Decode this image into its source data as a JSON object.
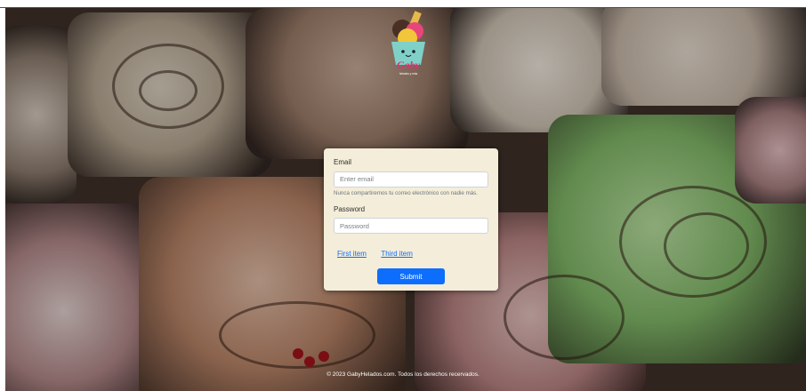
{
  "logo": {
    "name": "Gaby",
    "tagline": "helados y más"
  },
  "form": {
    "email_label": "Email",
    "email_placeholder": "Enter email",
    "email_help": "Nunca compartiremos tu correo electrónico con nadie más.",
    "password_label": "Password",
    "password_placeholder": "Password",
    "links": [
      "First item",
      "Third item"
    ],
    "submit_label": "Submit"
  },
  "footer": {
    "text": "© 2023 GabyHelados.com. Todos los derechos recervados."
  },
  "colors": {
    "accent": "#0d6efd",
    "card": "#f4edd9",
    "top_border": "#2c5d5d"
  }
}
